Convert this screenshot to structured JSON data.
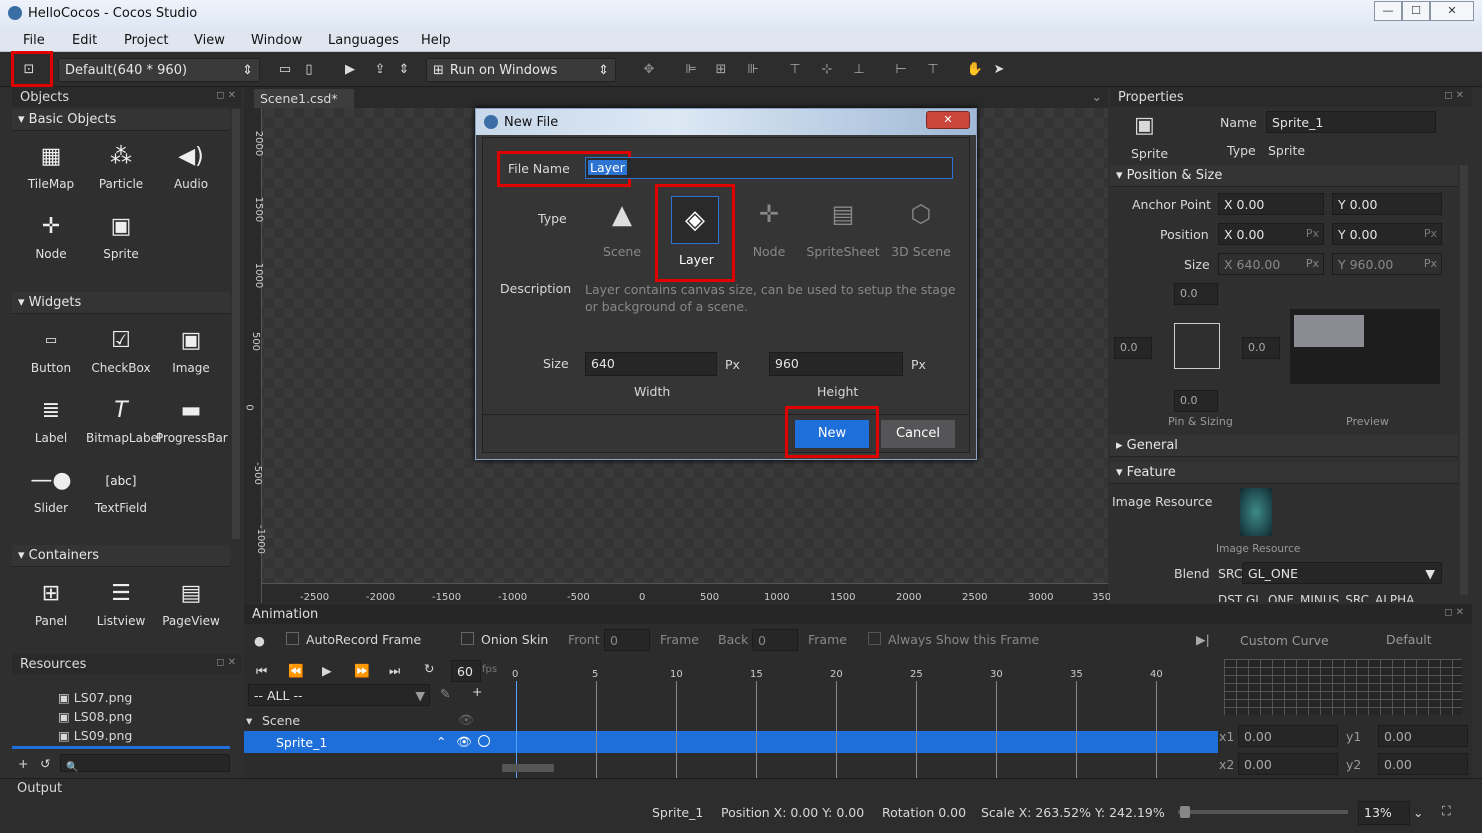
{
  "window": {
    "title": "HelloCocos - Cocos Studio",
    "min": "—",
    "max": "☐",
    "close": "✕"
  },
  "menu": [
    "File",
    "Edit",
    "Project",
    "View",
    "Window",
    "Languages",
    "Help"
  ],
  "toolbar": {
    "resolution": "Default(640 * 960)",
    "run": "Run on Windows"
  },
  "objects": {
    "title": "Objects",
    "basic": {
      "label": "Basic Objects",
      "items": [
        "TileMap",
        "Particle",
        "Audio",
        "Node",
        "Sprite"
      ]
    },
    "widgets": {
      "label": "Widgets",
      "items": [
        "Button",
        "CheckBox",
        "Image",
        "Label",
        "BitmapLabel",
        "ProgressBar",
        "Slider",
        "TextField"
      ]
    },
    "containers": {
      "label": "Containers",
      "items": [
        "Panel",
        "Listview",
        "PageView"
      ]
    }
  },
  "resources": {
    "title": "Resources",
    "files": [
      "LS07.png",
      "LS08.png",
      "LS09.png"
    ]
  },
  "tab": {
    "label": "Scene1.csd*"
  },
  "ruler": {
    "v": [
      "2000",
      "1500",
      "1000",
      "500",
      "0",
      "-500",
      "-1000"
    ],
    "h": [
      "-2500",
      "-2000",
      "-1500",
      "-1000",
      "-500",
      "0",
      "500",
      "1000",
      "1500",
      "2000",
      "2500",
      "3000",
      "350"
    ]
  },
  "dialog": {
    "title": "New File",
    "file_name_label": "File Name",
    "file_name": "Layer",
    "type_label": "Type",
    "types": [
      "Scene",
      "Layer",
      "Node",
      "SpriteSheet",
      "3D Scene"
    ],
    "description_label": "Description",
    "description": "Layer contains canvas size, can be used to setup the stage or background of a scene.",
    "size_label": "Size",
    "width": "640",
    "height": "960",
    "px": "Px",
    "width_label": "Width",
    "height_label": "Height",
    "new": "New",
    "cancel": "Cancel"
  },
  "properties": {
    "title": "Properties",
    "thumb_label": "Sprite",
    "name_label": "Name",
    "name": "Sprite_1",
    "type_label": "Type",
    "type": "Sprite",
    "pos_section": "Position & Size",
    "anchor_label": "Anchor Point",
    "anchor_x": "0.00",
    "anchor_y": "0.00",
    "position_label": "Position",
    "pos_x": "0.00",
    "pos_y": "0.00",
    "size_label": "Size",
    "size_x": "640.00",
    "size_y": "960.00",
    "px": "Px",
    "pin_top": "0.0",
    "pin_left": "0.0",
    "pin_right": "0.0",
    "pin_bottom": "0.0",
    "pin_label": "Pin & Sizing",
    "preview_label": "Preview",
    "general": "General",
    "feature": "Feature",
    "image_resource": "Image Resource",
    "image_resource_caption": "Image Resource",
    "blend_label": "Blend",
    "src_label": "SRC",
    "src": "GL_ONE",
    "dst": "DST GL_ONE_MINUS_SRC_ALPHA"
  },
  "animation": {
    "title": "Animation",
    "autorecord": "AutoRecord Frame",
    "onion": "Onion Skin",
    "front": "Front",
    "front_val": "0",
    "frame": "Frame",
    "back": "Back",
    "back_val": "0",
    "always": "Always Show this Frame",
    "fps": "60",
    "fps_unit": "fps",
    "filter": "-- ALL --",
    "scene": "Scene",
    "sprite": "Sprite_1",
    "ticks": [
      "0",
      "5",
      "10",
      "15",
      "20",
      "25",
      "30",
      "35",
      "40"
    ],
    "curve": "Custom Curve",
    "default": "Default",
    "x1": "0.00",
    "y1": "0.00",
    "x2": "0.00",
    "y2": "0.00"
  },
  "output": {
    "title": "Output"
  },
  "status": {
    "name": "Sprite_1",
    "position": "Position X: 0.00  Y: 0.00",
    "rotation": "Rotation 0.00",
    "scale": "Scale X: 263.52%  Y: 242.19%",
    "zoom": "13%"
  }
}
